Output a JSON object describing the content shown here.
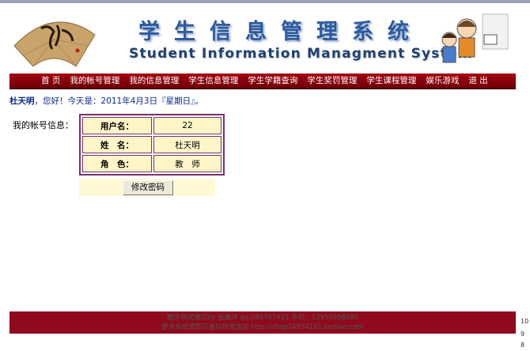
{
  "header": {
    "title_cn": "学生信息管理系统",
    "title_en": "Student Information Managment System"
  },
  "nav": {
    "items": [
      "首 页",
      "我的帐号管理",
      "我的信息管理",
      "学生信息管理",
      "学生学籍查询",
      "学生奖罚管理",
      "学生课程管理",
      "娱乐游戏",
      "退 出"
    ]
  },
  "greeting": {
    "name": "杜天明",
    "text": "，您好！今天是：2011年4月3日『星期日』。"
  },
  "account": {
    "section_label": "我的帐号信息：",
    "rows": [
      {
        "key": "用户名：",
        "value": "22"
      },
      {
        "key": "姓　名：",
        "value": "杜天明"
      },
      {
        "key": "角　色：",
        "value": "教　师"
      }
    ],
    "change_password_button": "修改密码"
  },
  "footer": {
    "line1": "程序测试通过by 张鑫炜 qq:285707421 手机：13956998089",
    "line2": "更多系统请到万鑫科技淘宝店 http://shop34954101.taobao.com"
  },
  "side_numbers": [
    "10",
    "9",
    "8"
  ]
}
